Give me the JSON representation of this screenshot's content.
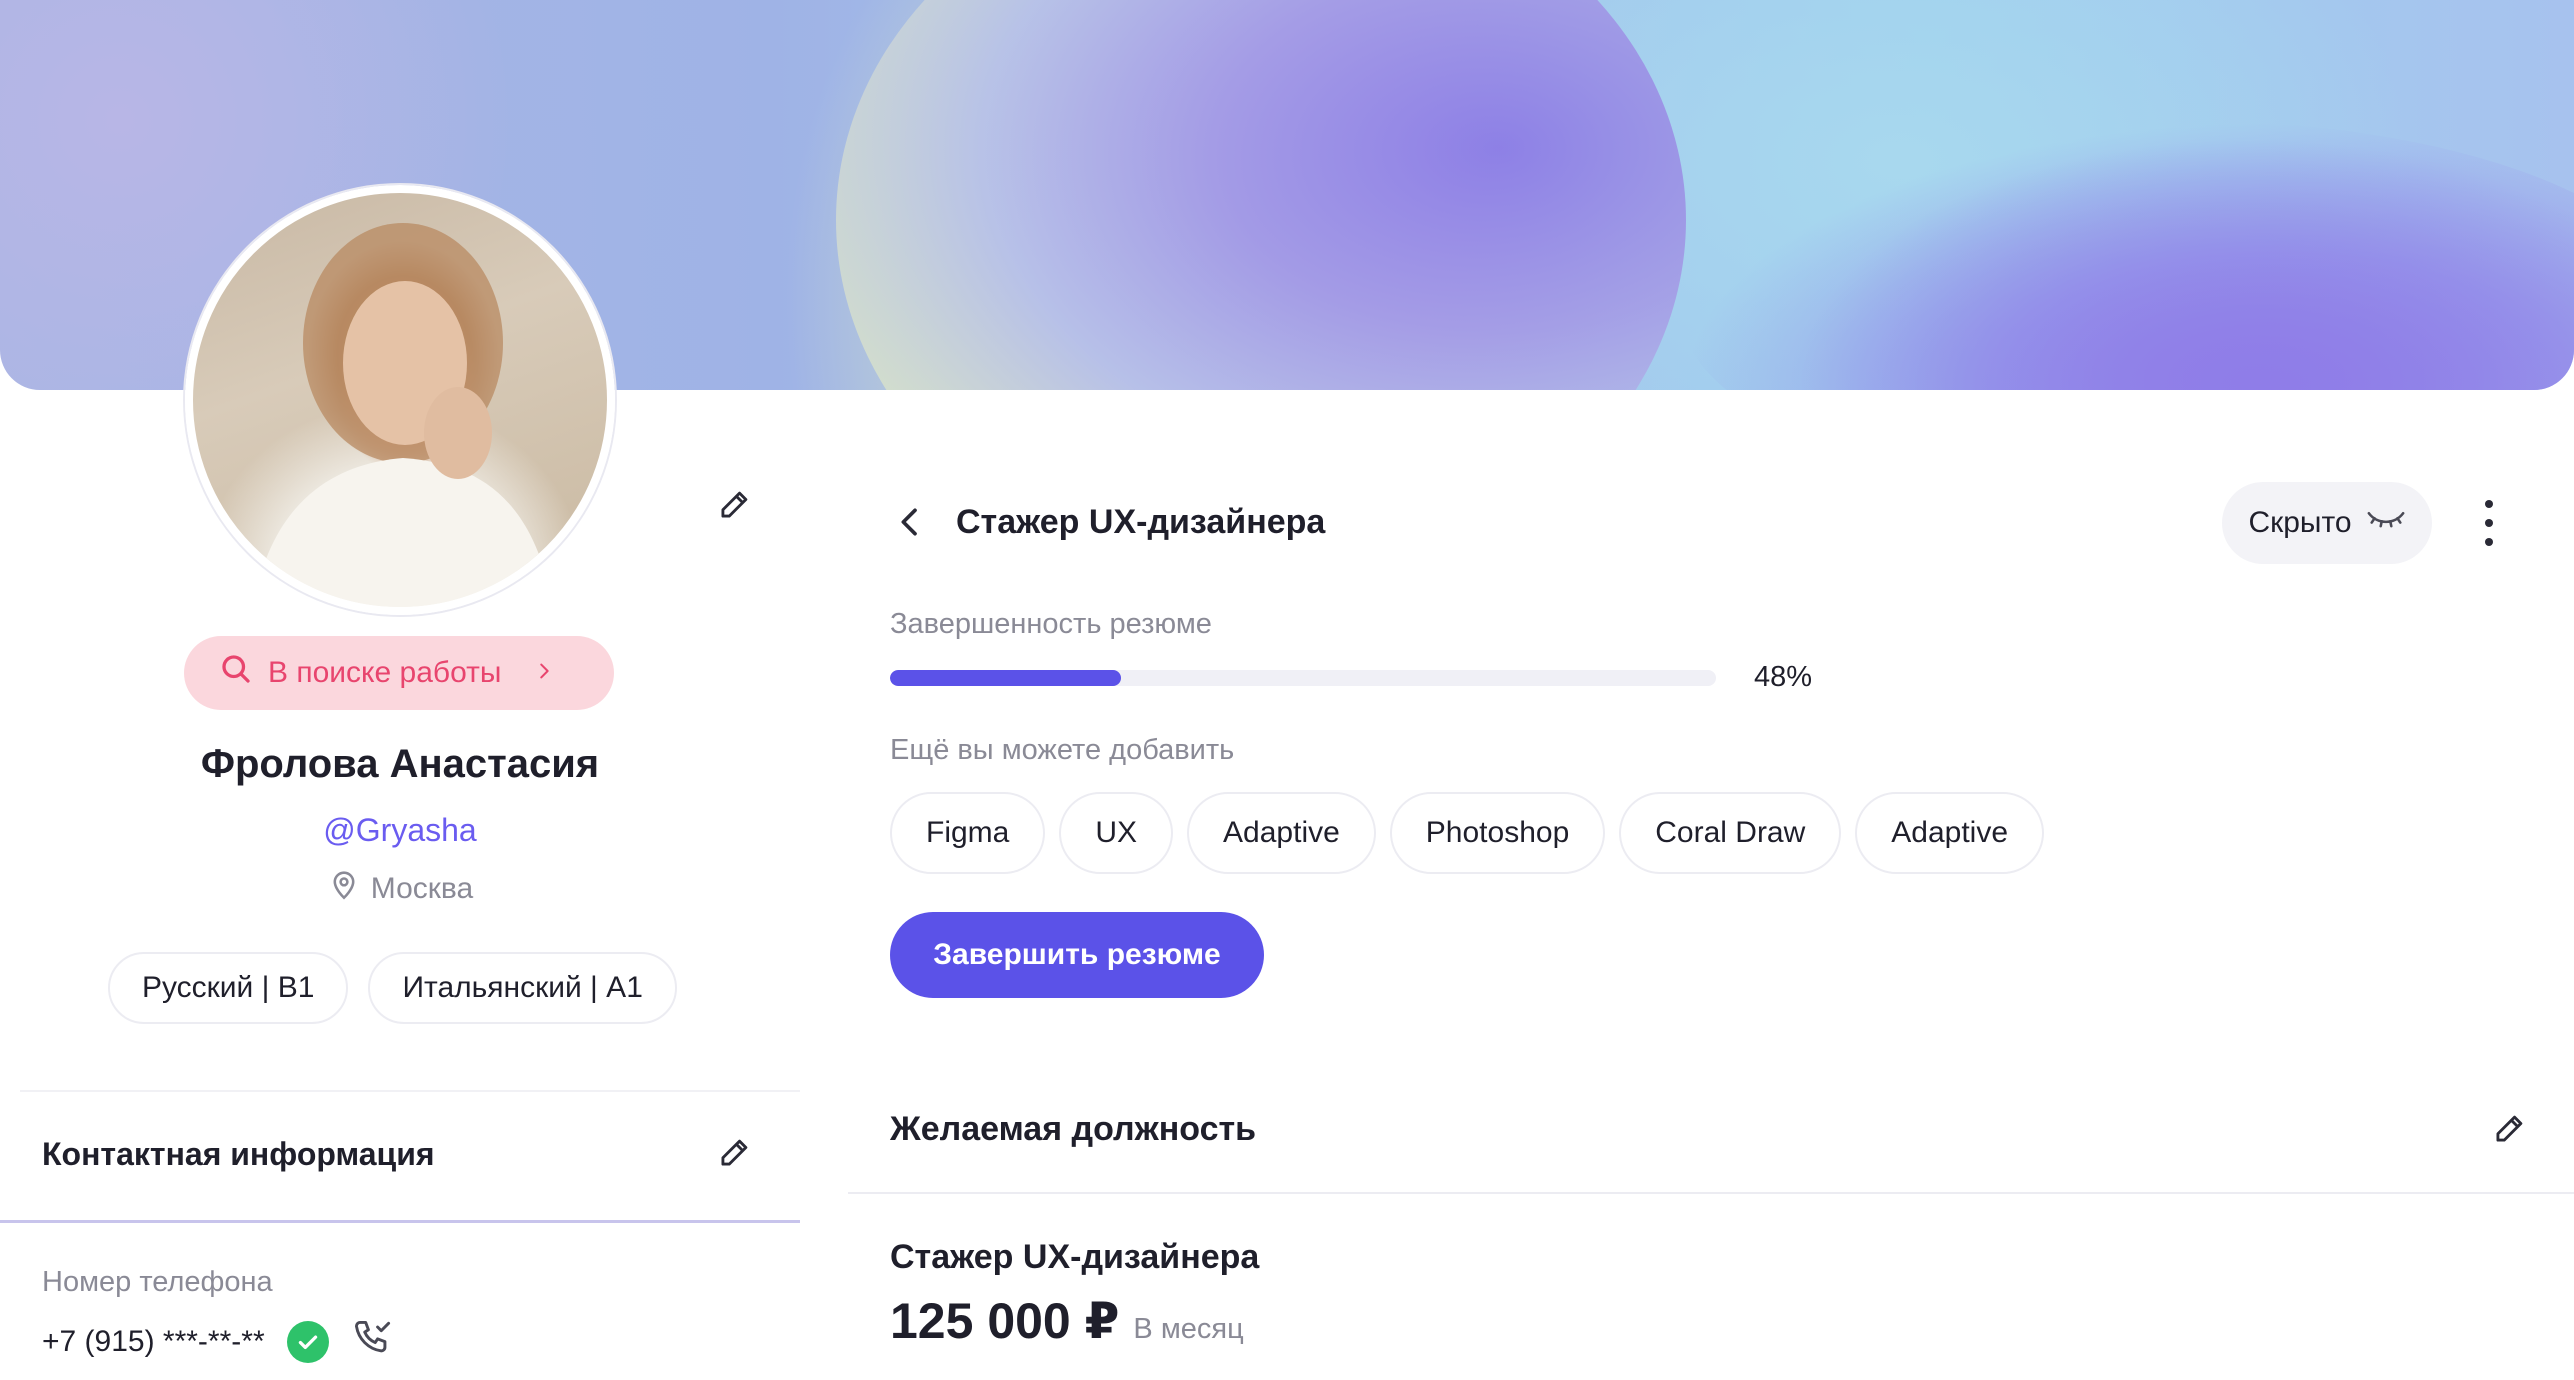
{
  "profile": {
    "status": "В поиске работы",
    "name": "Фролова Анастасия",
    "handle": "@Gryasha",
    "city": "Москва",
    "languages": [
      "Русский | B1",
      "Итальянский | A1"
    ]
  },
  "contacts": {
    "title": "Контактная информация",
    "phone_label": "Номер телефона",
    "phone_value": "+7 (915) ***-**-**"
  },
  "resume": {
    "title": "Стажер UX-дизайнера",
    "visibility": "Скрыто",
    "completion_label": "Завершенность резюме",
    "completion_value": "48%",
    "completion_fraction": 0.28,
    "add_label": "Ещё вы можете добавить",
    "suggested_skills": [
      "Figma",
      "UX",
      "Adaptive",
      "Photoshop",
      "Coral Draw",
      "Adaptive"
    ],
    "finish_button": "Завершить резюме"
  },
  "desired": {
    "section_title": "Желаемая должность",
    "position": "Стажер UX-дизайнера",
    "salary": "125 000 ₽",
    "period": "В месяц"
  },
  "colors": {
    "accent": "#5b52e8",
    "status_bg": "#fbd7dd",
    "status_text": "#e8456e",
    "verified": "#2ec26a"
  },
  "icons": [
    "pencil-icon",
    "search-icon",
    "chevron-right-icon",
    "location-pin-icon",
    "chevron-left-icon",
    "eye-closed-icon",
    "more-vertical-icon",
    "check-icon",
    "phone-check-icon"
  ]
}
